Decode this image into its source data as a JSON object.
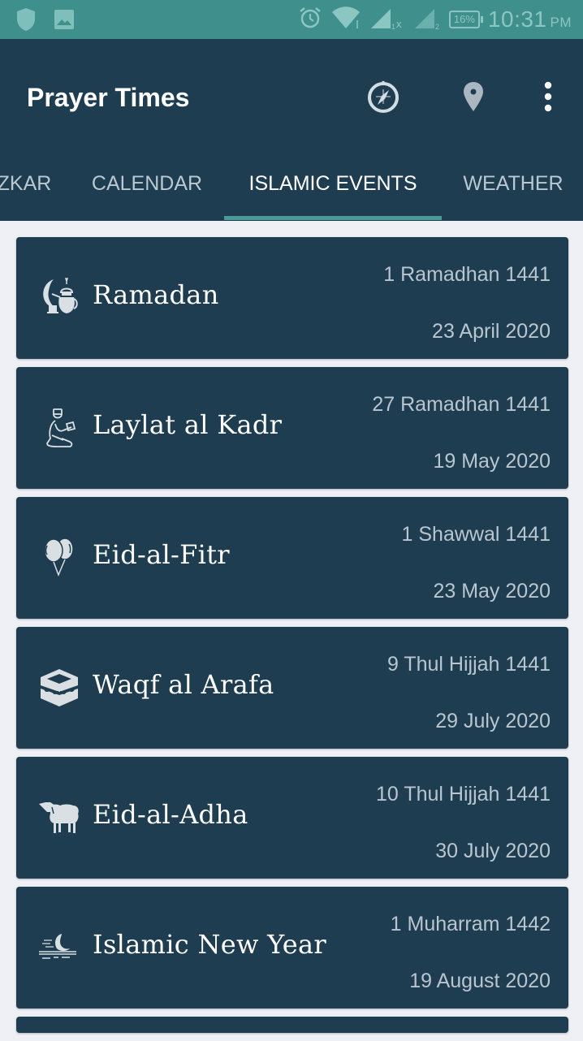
{
  "status_bar": {
    "icons": [
      "shield-icon",
      "image-icon",
      "alarm-icon",
      "wifi-icon",
      "signal-sim1-icon",
      "signal-sim2-icon"
    ],
    "battery": "16%",
    "time": "10:31",
    "ampm": "PM"
  },
  "app_bar": {
    "title": "Prayer Times",
    "actions": [
      "compass-icon",
      "location-pin-icon",
      "more-vert-icon"
    ]
  },
  "tabs": [
    {
      "label": "ZKAR",
      "active": false
    },
    {
      "label": "CALENDAR",
      "active": false
    },
    {
      "label": "ISLAMIC EVENTS",
      "active": true
    },
    {
      "label": "WEATHER",
      "active": false
    }
  ],
  "events": [
    {
      "name": "Ramadan",
      "icon": "crescent-lantern-icon",
      "hijri": "1 Ramadhan 1441",
      "gregorian": "23 April 2020"
    },
    {
      "name": "Laylat al Kadr",
      "icon": "praying-man-icon",
      "hijri": "27 Ramadhan 1441",
      "gregorian": "19 May 2020"
    },
    {
      "name": "Eid-al-Fitr",
      "icon": "balloons-icon",
      "hijri": "1 Shawwal 1441",
      "gregorian": "23 May 2020"
    },
    {
      "name": "Waqf al Arafa",
      "icon": "kaaba-icon",
      "hijri": "9 Thul Hijjah 1441",
      "gregorian": "29 July 2020"
    },
    {
      "name": "Eid-al-Adha",
      "icon": "sheep-icon",
      "hijri": "10 Thul Hijjah 1441",
      "gregorian": "30 July 2020"
    },
    {
      "name": "Islamic New Year",
      "icon": "crescent-horizon-icon",
      "hijri": "1 Muharram 1442",
      "gregorian": "19 August 2020"
    }
  ],
  "colors": {
    "status_bar": "#3f8f8c",
    "app_bar": "#1f3d51",
    "card": "#1f3d51",
    "tab_indicator": "#4a9a98",
    "background": "#eef0f5"
  }
}
